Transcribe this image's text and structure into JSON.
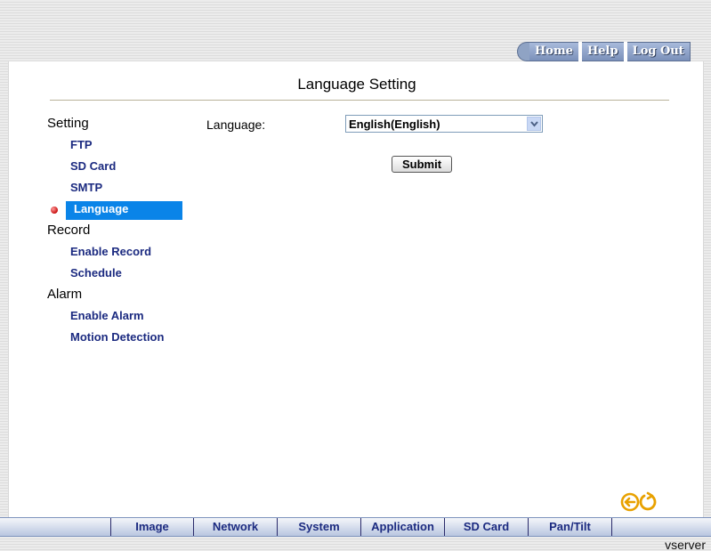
{
  "top_nav": {
    "home": "Home",
    "help": "Help",
    "logout": "Log Out"
  },
  "page": {
    "title": "Language Setting"
  },
  "sidebar": {
    "sections": [
      {
        "header": "Setting",
        "items": [
          "FTP",
          "SD Card",
          "SMTP",
          "Language"
        ]
      },
      {
        "header": "Record",
        "items": [
          "Enable Record",
          "Schedule"
        ]
      },
      {
        "header": "Alarm",
        "items": [
          "Enable Alarm",
          "Motion Detection"
        ]
      }
    ],
    "active_item": "Language"
  },
  "form": {
    "language_label": "Language:",
    "language_value": "English(English)",
    "submit_label": "Submit"
  },
  "bottom_tabs": [
    "Image",
    "Network",
    "System",
    "Application",
    "SD Card",
    "Pan/Tilt"
  ],
  "footer": {
    "brand": "vserver"
  },
  "colors": {
    "accent": "#0a84e8",
    "link": "#1b2a80",
    "icon_orange": "#e8a100",
    "nav_blue": "#7b91ba"
  },
  "icons": {
    "back": "back-arrow-icon",
    "refresh": "refresh-icon",
    "dropdown": "chevron-down-icon",
    "bullet": "active-bullet-icon"
  }
}
